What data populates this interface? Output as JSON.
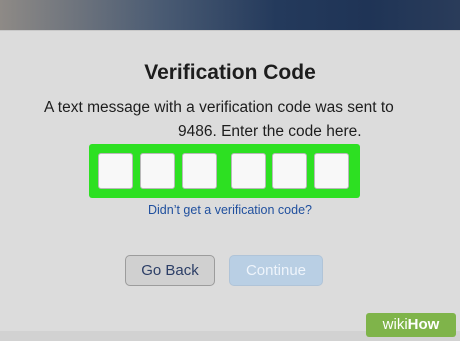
{
  "dialog": {
    "title": "Verification Code",
    "message_line1": "A text message with a verification code was sent to",
    "message_line2": "9486. Enter the code here.",
    "code_digits": [
      "",
      "",
      "",
      "",
      "",
      ""
    ],
    "resend_link": "Didn’t get a verification code?",
    "back_label": "Go Back",
    "continue_label": "Continue"
  },
  "watermark": {
    "part1": "wiki",
    "part2": "How"
  },
  "colors": {
    "highlight": "#2de022",
    "link": "#1f4f9e",
    "continue_disabled": "#b9cfe4"
  }
}
